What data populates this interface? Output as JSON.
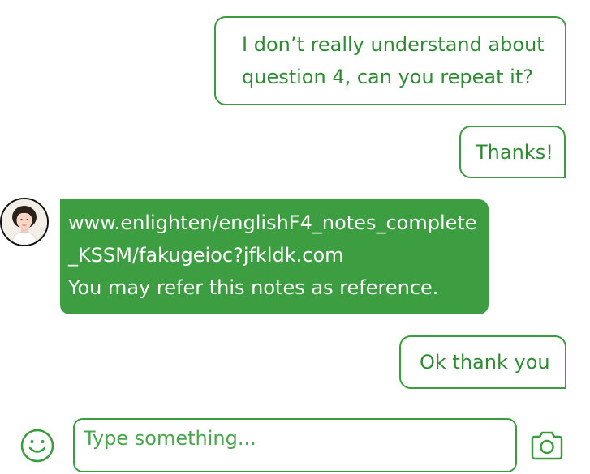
{
  "messages": [
    {
      "direction": "outgoing",
      "lines": [
        "I don’t really understand about",
        "question 4, can you repeat it?"
      ]
    },
    {
      "direction": "outgoing",
      "lines": [
        "Thanks!"
      ]
    },
    {
      "direction": "incoming",
      "lines": [
        "www.enlighten/englishF4_notes_complete",
        "_KSSM/fakugeioc?jfkldk.com",
        "You may refer this notes as reference."
      ]
    },
    {
      "direction": "outgoing",
      "lines": [
        "Ok thank you"
      ]
    }
  ],
  "composer": {
    "placeholder": "Type something...",
    "emoji_icon": "smiley-icon",
    "camera_icon": "camera-icon"
  },
  "colors": {
    "accent": "#3c9e40",
    "text_green": "#2e8b34",
    "incoming_text": "#ffffff"
  }
}
